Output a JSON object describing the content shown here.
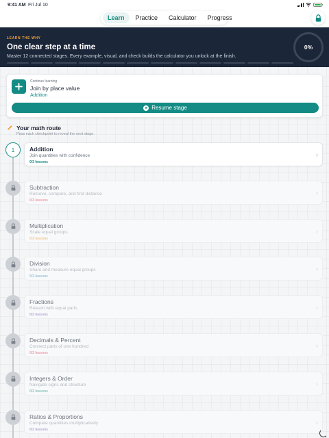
{
  "status_bar": {
    "time": "9:41 AM",
    "date": "Fri Jul 10",
    "battery_level": 1.0
  },
  "nav": {
    "tabs": [
      {
        "label": "Learn",
        "active": true
      },
      {
        "label": "Practice",
        "active": false
      },
      {
        "label": "Calculator",
        "active": false
      },
      {
        "label": "Progress",
        "active": false
      }
    ],
    "lock_icon": "lock-icon"
  },
  "hero": {
    "eyebrow": "LEARN THE WHY",
    "headline": "One clear step at a time",
    "description": "Master 12 connected stages. Every example, visual, and check builds the calculator you unlock at the finish.",
    "progress": "0%",
    "progress_value": 0,
    "stage_count": 12
  },
  "continue_card": {
    "eyebrow": "Continue learning",
    "title": "Join by place value",
    "subtitle": "Addition",
    "button_label": "Resume stage",
    "icon": "plus-icon"
  },
  "route": {
    "title": "Your math route",
    "subtitle": "Pass each checkpoint to reveal the next stage.",
    "icon": "pencil-icon"
  },
  "stages": [
    {
      "number": "1",
      "name": "Addition",
      "desc": "Join quantities with confidence",
      "lessons": "0/3 lessons",
      "lessons_color": "#148b84",
      "locked": false
    },
    {
      "name": "Subtraction",
      "desc": "Remove, compare, and find distance",
      "lessons": "0/3 lessons",
      "lessons_color": "#f0a3ad",
      "locked": true
    },
    {
      "name": "Multiplication",
      "desc": "Scale equal groups",
      "lessons": "0/3 lessons",
      "lessons_color": "#f3c98d",
      "locked": true
    },
    {
      "name": "Division",
      "desc": "Share and measure equal groups",
      "lessons": "0/3 lessons",
      "lessons_color": "#9fc2dc",
      "locked": true
    },
    {
      "name": "Fractions",
      "desc": "Reason with equal parts",
      "lessons": "0/3 lessons",
      "lessons_color": "#b7a8d9",
      "locked": true
    },
    {
      "name": "Decimals & Percent",
      "desc": "Connect parts of one hundred",
      "lessons": "0/3 lessons",
      "lessons_color": "#ee9fae",
      "locked": true
    },
    {
      "name": "Integers & Order",
      "desc": "Navigate signs and structure",
      "lessons": "0/3 lessons",
      "lessons_color": "#8cc7c1",
      "locked": true
    },
    {
      "name": "Ratios & Proportions",
      "desc": "Compare quantities multiplicatively",
      "lessons": "0/3 lessons",
      "lessons_color": "#b7a8d9",
      "locked": true
    }
  ]
}
